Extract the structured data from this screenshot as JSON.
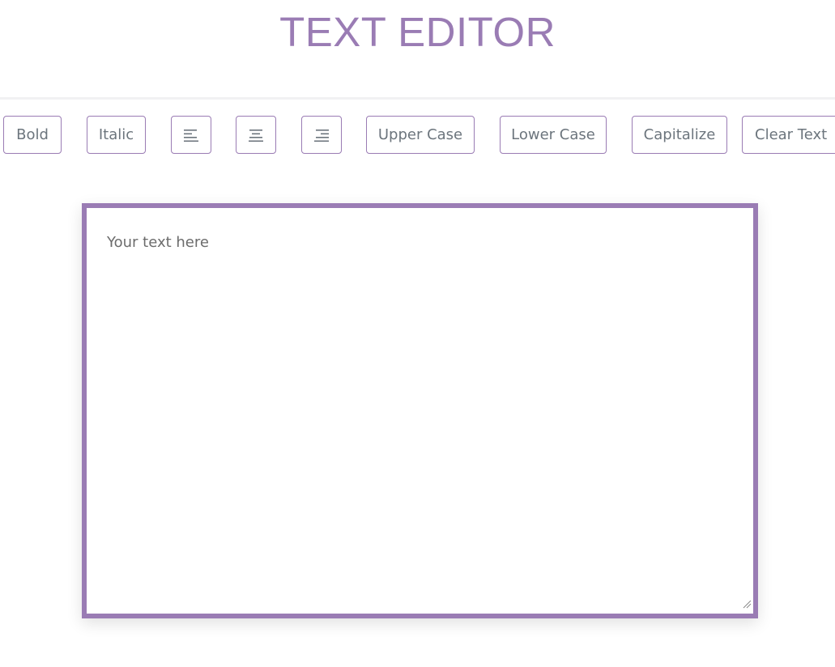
{
  "header": {
    "title": "TEXT EDITOR"
  },
  "toolbar": {
    "bold_label": "Bold",
    "italic_label": "Italic",
    "align_left_icon": "align-left-icon",
    "align_center_icon": "align-center-icon",
    "align_right_icon": "align-right-icon",
    "upper_label": "Upper Case",
    "lower_label": "Lower Case",
    "capitalize_label": "Capitalize",
    "clear_label": "Clear Text"
  },
  "editor": {
    "placeholder": "Your text here",
    "value": ""
  },
  "colors": {
    "accent": "#9a7cb4",
    "button_text": "#6c757d",
    "background": "#ffffff"
  }
}
